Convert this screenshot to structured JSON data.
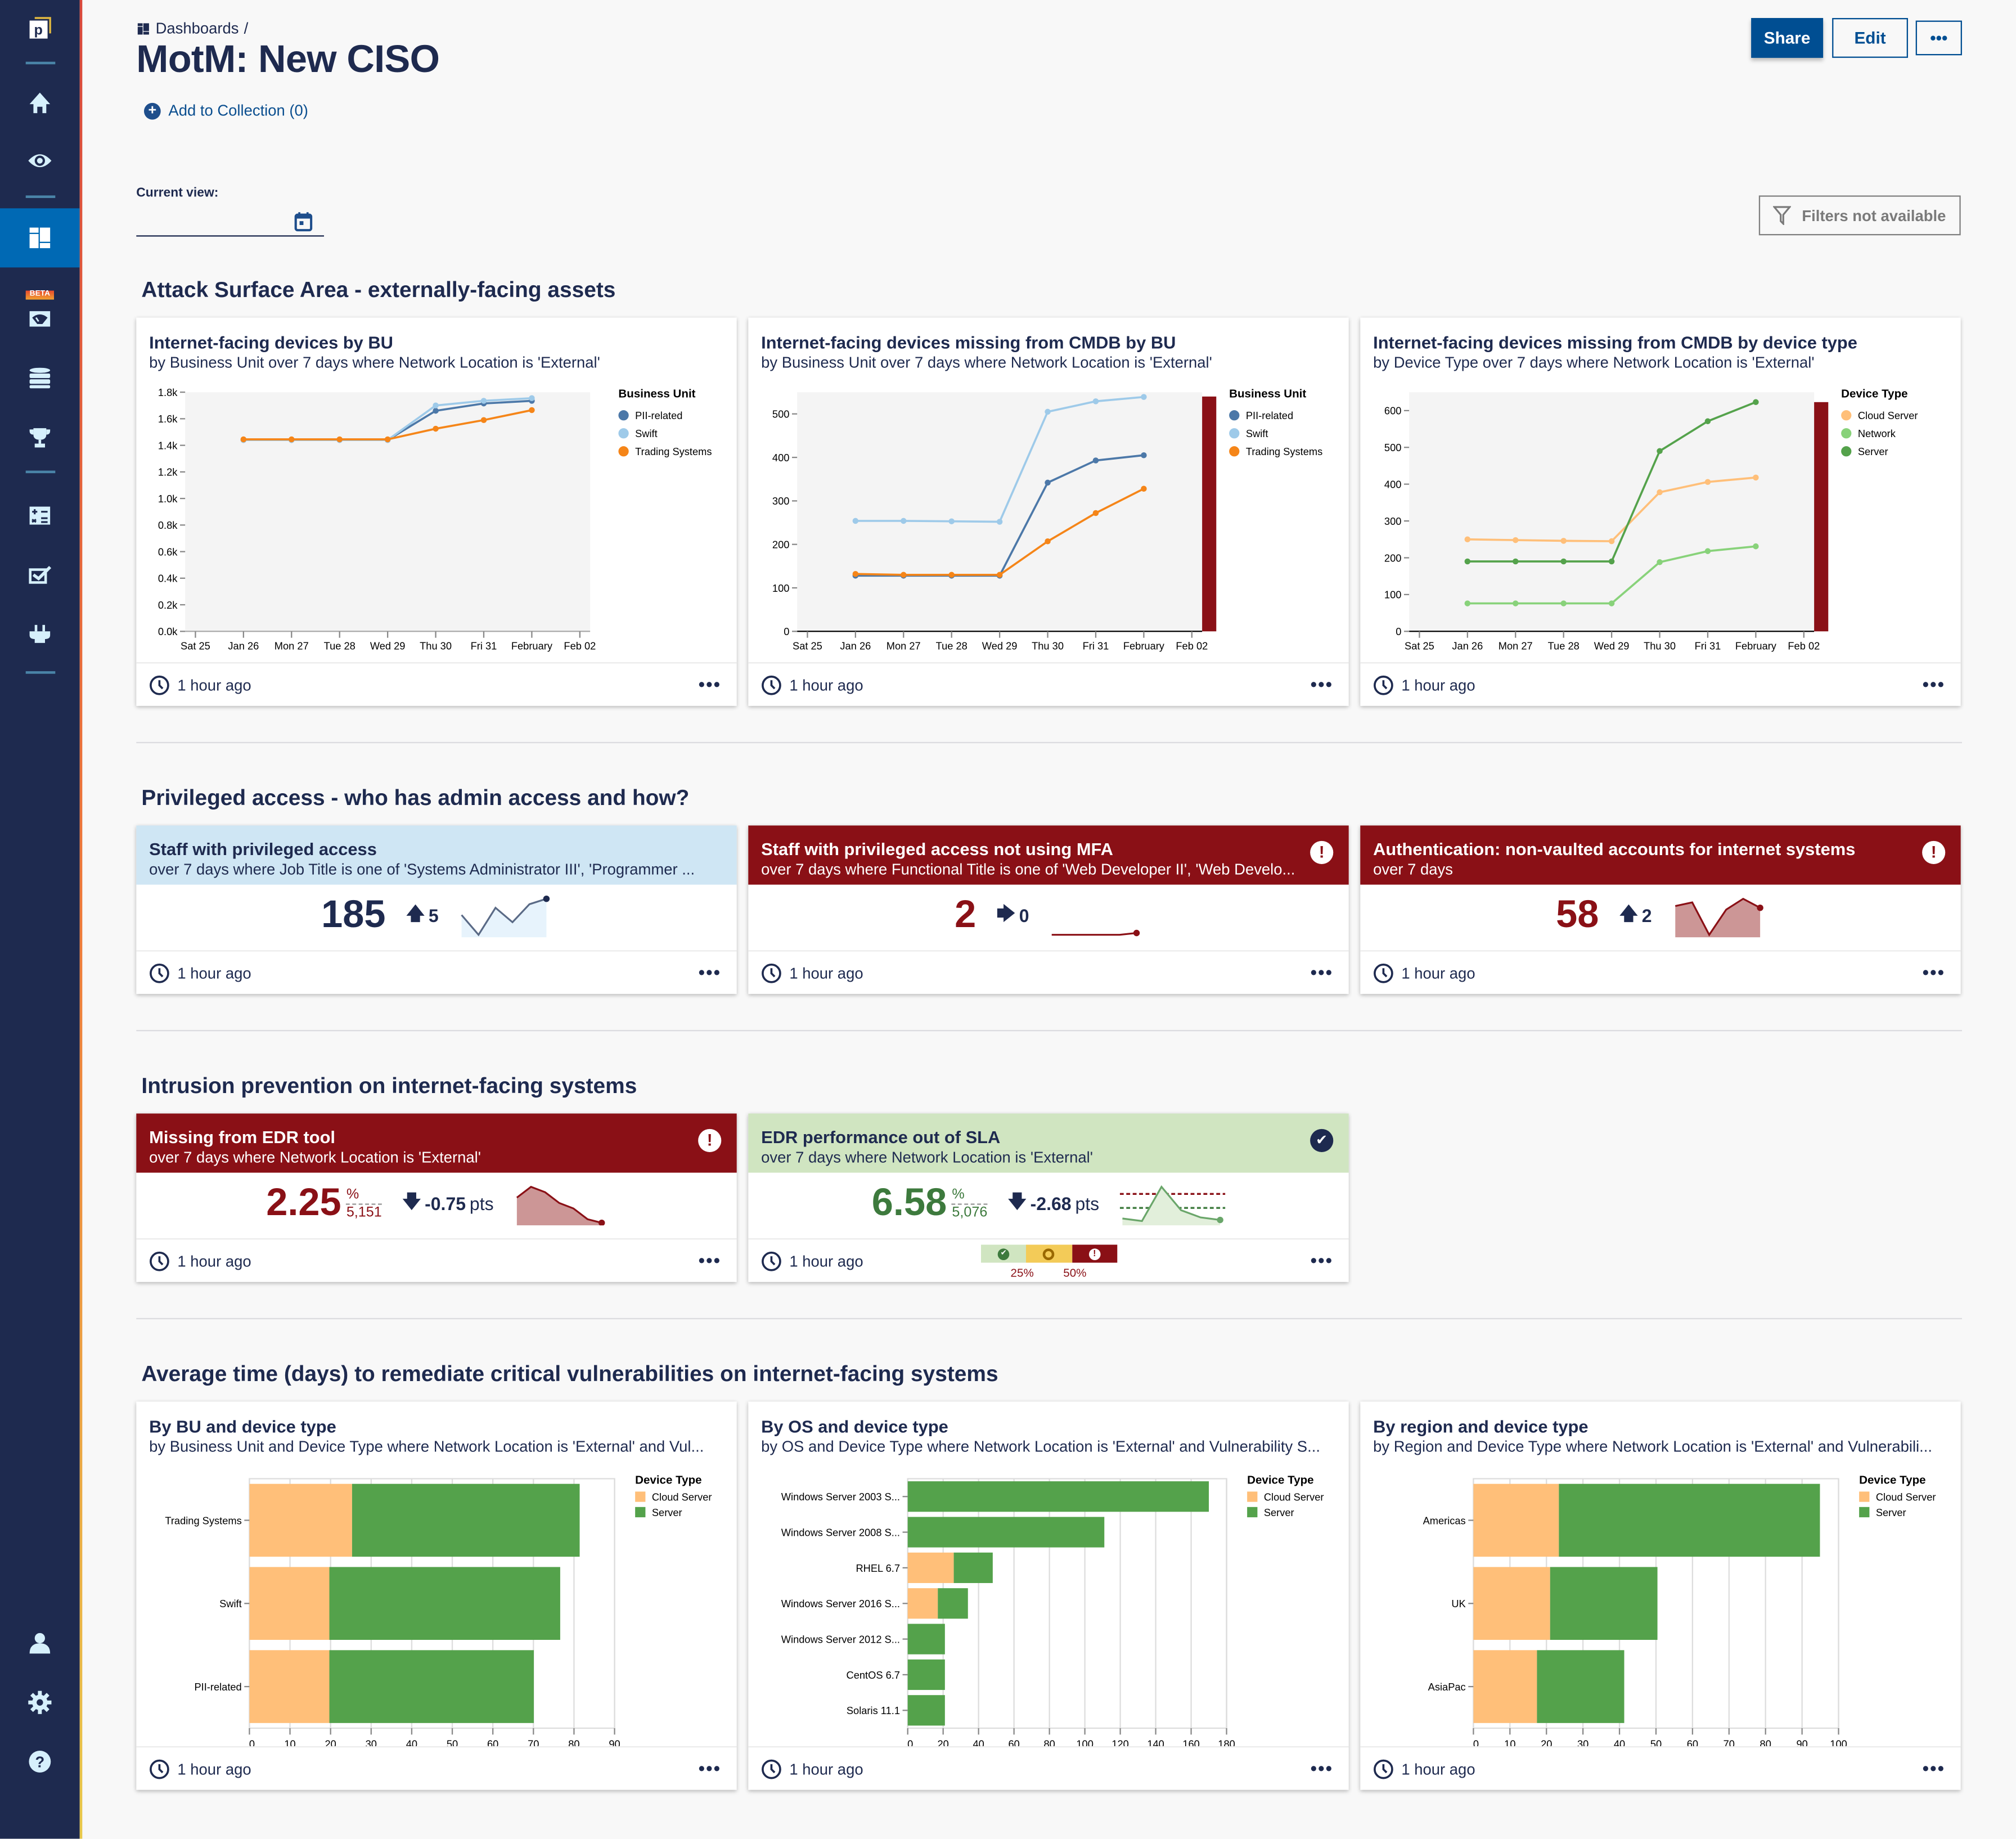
{
  "sidebar": {
    "logo": "p",
    "beta_label": "BETA",
    "items": [
      {
        "icon": "home-icon"
      },
      {
        "icon": "eye-icon"
      },
      {
        "icon": "dashboard-icon",
        "active": true
      },
      {
        "icon": "gauge-icon",
        "badge": "BETA"
      },
      {
        "icon": "database-icon"
      },
      {
        "icon": "trophy-icon"
      },
      {
        "icon": "calculator-icon"
      },
      {
        "icon": "checkbox-icon"
      },
      {
        "icon": "plug-icon"
      },
      {
        "icon": "user-icon"
      },
      {
        "icon": "gear-icon"
      },
      {
        "icon": "help-icon"
      }
    ]
  },
  "header": {
    "breadcrumb": "Dashboards",
    "breadcrumb_sep": "/",
    "title": "MotM: New CISO",
    "add_to_collection": "Add to Collection (0)",
    "share_label": "Share",
    "edit_label": "Edit",
    "more_label": "•••",
    "current_view_label": "Current view:",
    "current_view_value": "",
    "filters_label": "Filters not available"
  },
  "colors": {
    "navy": "#1e2a4f",
    "brand_blue": "#004e92",
    "alert_red": "#8a1016",
    "good_green": "#3d7a3d",
    "pii": "#4c78a8",
    "swift": "#9ecae9",
    "trading": "#f58518",
    "cloud_server": "#ffbf79",
    "network": "#88d27a",
    "server": "#54a24b"
  },
  "footer_time": "1 hour ago",
  "sections": [
    {
      "title": "Attack Surface Area - externally-facing assets"
    },
    {
      "title": "Privileged access - who has admin access and how?"
    },
    {
      "title": "Intrusion prevention on internet-facing systems"
    },
    {
      "title": "Average time (days) to remediate critical vulnerabilities on internet-facing systems"
    }
  ],
  "line_cards": [
    {
      "title": "Internet-facing devices by BU",
      "subtitle": "by Business Unit over 7 days where Network Location is 'External'"
    },
    {
      "title": "Internet-facing devices missing from CMDB by BU",
      "subtitle": "by Business Unit over 7 days where Network Location is 'External'"
    },
    {
      "title": "Internet-facing devices missing from CMDB by device type",
      "subtitle": "by Device Type over 7 days where Network Location is 'External'"
    }
  ],
  "kpi_cards": [
    {
      "title": "Staff with privileged access",
      "subtitle": "over 7 days where Job Title is one of 'Systems Administrator III', 'Programmer ...",
      "value": "185",
      "delta": "5",
      "delta_dir": "up",
      "sparkline": [
        0.55,
        0.0,
        0.75,
        0.35,
        0.85,
        1.0
      ]
    },
    {
      "title": "Staff with privileged access not using MFA",
      "subtitle": "over 7 days where Functional Title is one of 'Web Developer II', 'Web Develo...",
      "value": "2",
      "delta": "0",
      "delta_dir": "flat",
      "sparkline": [
        0,
        0,
        0,
        0,
        0,
        0.05
      ]
    },
    {
      "title": "Authentication: non-vaulted accounts for internet systems",
      "subtitle": "over 7 days",
      "value": "58",
      "delta": "2",
      "delta_dir": "up",
      "sparkline": [
        0.8,
        0.9,
        0.0,
        0.7,
        1.0,
        0.75
      ]
    },
    {
      "title": "Missing from EDR tool",
      "subtitle": "over 7 days where Network Location is 'External'",
      "value": "2.25",
      "unit": "%",
      "denominator": "5,151",
      "delta": "-0.75",
      "delta_unit": "pts",
      "delta_dir": "down",
      "sparkline": [
        0.7,
        1.0,
        0.85,
        0.55,
        0.4,
        0.1,
        0.0
      ]
    },
    {
      "title": "EDR performance out of SLA",
      "subtitle": "over 7 days where Network Location is 'External'",
      "value": "6.58",
      "unit": "%",
      "denominator": "5,076",
      "delta": "-2.68",
      "delta_unit": "pts",
      "delta_dir": "down",
      "sparkline": [
        0.12,
        0.05,
        1.0,
        0.35,
        0.15,
        0.08
      ],
      "thresholds": {
        "labels": [
          "25%",
          "50%"
        ],
        "values": [
          25,
          50
        ]
      }
    }
  ],
  "bar_cards": [
    {
      "title": "By BU and device type",
      "subtitle": "by Business Unit and Device Type where Network Location is 'External' and Vul..."
    },
    {
      "title": "By OS and device type",
      "subtitle": "by OS and Device Type where Network Location is 'External' and Vulnerability S..."
    },
    {
      "title": "By region and device type",
      "subtitle": "by Region and Device Type where Network Location is 'External' and Vulnerabili..."
    }
  ],
  "chart_data": [
    {
      "type": "line",
      "title": "Internet-facing devices by BU",
      "legend_title": "Business Unit",
      "legend_position": "right",
      "x_ticks": [
        "Sat 25",
        "Jan 26",
        "Mon 27",
        "Tue 28",
        "Wed 29",
        "Thu 30",
        "Fri 31",
        "February",
        "Feb 02"
      ],
      "y_ticks": [
        "0.0k",
        "0.2k",
        "0.4k",
        "0.6k",
        "0.8k",
        "1.0k",
        "1.2k",
        "1.4k",
        "1.6k",
        "1.8k"
      ],
      "ylim": [
        0,
        1800
      ],
      "x": [
        "Jan 26",
        "Mon 27",
        "Tue 28",
        "Wed 29",
        "Thu 30",
        "Fri 31",
        "February"
      ],
      "series": [
        {
          "name": "PII-related",
          "color": "#4c78a8",
          "values": [
            1440,
            1440,
            1440,
            1440,
            1660,
            1715,
            1735
          ]
        },
        {
          "name": "Swift",
          "color": "#9ecae9",
          "values": [
            1440,
            1440,
            1440,
            1440,
            1700,
            1735,
            1755
          ]
        },
        {
          "name": "Trading Systems",
          "color": "#f58518",
          "values": [
            1445,
            1445,
            1445,
            1445,
            1525,
            1590,
            1665
          ]
        }
      ]
    },
    {
      "type": "line",
      "title": "Internet-facing devices missing from CMDB by BU",
      "legend_title": "Business Unit",
      "legend_position": "right",
      "x_ticks": [
        "Sat 25",
        "Jan 26",
        "Mon 27",
        "Tue 28",
        "Wed 29",
        "Thu 30",
        "Fri 31",
        "February",
        "Feb 02"
      ],
      "y_ticks": [
        "0",
        "100",
        "200",
        "300",
        "400",
        "500"
      ],
      "ylim": [
        0,
        550
      ],
      "threshold_bar_max": 540,
      "x": [
        "Jan 26",
        "Mon 27",
        "Tue 28",
        "Wed 29",
        "Thu 30",
        "Fri 31",
        "February"
      ],
      "series": [
        {
          "name": "PII-related",
          "color": "#4c78a8",
          "values": [
            128,
            128,
            128,
            128,
            342,
            393,
            405
          ]
        },
        {
          "name": "Swift",
          "color": "#9ecae9",
          "values": [
            254,
            254,
            253,
            252,
            505,
            529,
            539
          ]
        },
        {
          "name": "Trading Systems",
          "color": "#f58518",
          "values": [
            132,
            130,
            130,
            130,
            207,
            272,
            328
          ]
        }
      ]
    },
    {
      "type": "line",
      "title": "Internet-facing devices missing from CMDB by device type",
      "legend_title": "Device Type",
      "legend_position": "right",
      "x_ticks": [
        "Sat 25",
        "Jan 26",
        "Mon 27",
        "Tue 28",
        "Wed 29",
        "Thu 30",
        "Fri 31",
        "February",
        "Feb 02"
      ],
      "y_ticks": [
        "0",
        "100",
        "200",
        "300",
        "400",
        "500",
        "600"
      ],
      "ylim": [
        0,
        650
      ],
      "threshold_bar_max": 623,
      "x": [
        "Jan 26",
        "Mon 27",
        "Tue 28",
        "Wed 29",
        "Thu 30",
        "Fri 31",
        "February"
      ],
      "series": [
        {
          "name": "Cloud Server",
          "color": "#ffbf79",
          "values": [
            250,
            248,
            246,
            245,
            378,
            406,
            418
          ]
        },
        {
          "name": "Network",
          "color": "#88d27a",
          "values": [
            76,
            76,
            76,
            76,
            188,
            218,
            231
          ]
        },
        {
          "name": "Server",
          "color": "#54a24b",
          "values": [
            190,
            190,
            190,
            190,
            490,
            571,
            623
          ]
        }
      ]
    },
    {
      "type": "bar",
      "orientation": "horizontal",
      "stacked": true,
      "title": "By BU and device type",
      "legend_title": "Device Type",
      "legend_position": "right",
      "categories": [
        "Trading Systems",
        "Swift",
        "PII-related"
      ],
      "x_ticks": [
        "0",
        "10",
        "20",
        "30",
        "40",
        "50",
        "60",
        "70",
        "80",
        "90"
      ],
      "xlim": [
        0,
        90
      ],
      "series": [
        {
          "name": "Cloud Server",
          "color": "#ffbf79",
          "values": [
            25.3,
            19.7,
            19.7
          ]
        },
        {
          "name": "Server",
          "color": "#54a24b",
          "values": [
            56.1,
            56.9,
            50.4
          ]
        }
      ]
    },
    {
      "type": "bar",
      "orientation": "horizontal",
      "stacked": true,
      "title": "By OS and device type",
      "legend_title": "Device Type",
      "legend_position": "right",
      "categories": [
        "Windows Server 2003 S...",
        "Windows Server 2008 S...",
        "RHEL 6.7",
        "Windows Server 2016 S...",
        "Windows Server 2012 S...",
        "CentOS 6.7",
        "Solaris 11.1"
      ],
      "x_ticks": [
        "0",
        "20",
        "40",
        "60",
        "80",
        "100",
        "120",
        "140",
        "160",
        "180"
      ],
      "xlim": [
        0,
        180
      ],
      "series": [
        {
          "name": "Cloud Server",
          "color": "#ffbf79",
          "values": [
            0,
            0,
            26,
            17,
            0,
            0,
            0
          ]
        },
        {
          "name": "Server",
          "color": "#54a24b",
          "values": [
            170,
            111,
            22,
            17,
            21,
            21,
            21
          ]
        }
      ]
    },
    {
      "type": "bar",
      "orientation": "horizontal",
      "stacked": true,
      "title": "By region and device type",
      "legend_title": "Device Type",
      "legend_position": "right",
      "categories": [
        "Americas",
        "UK",
        "AsiaPac"
      ],
      "x_ticks": [
        "0",
        "10",
        "20",
        "30",
        "40",
        "50",
        "60",
        "70",
        "80",
        "90",
        "100"
      ],
      "xlim": [
        0,
        100
      ],
      "series": [
        {
          "name": "Cloud Server",
          "color": "#ffbf79",
          "values": [
            23.4,
            21,
            17.4
          ]
        },
        {
          "name": "Server",
          "color": "#54a24b",
          "values": [
            71.5,
            29.4,
            23.9
          ]
        }
      ]
    }
  ]
}
